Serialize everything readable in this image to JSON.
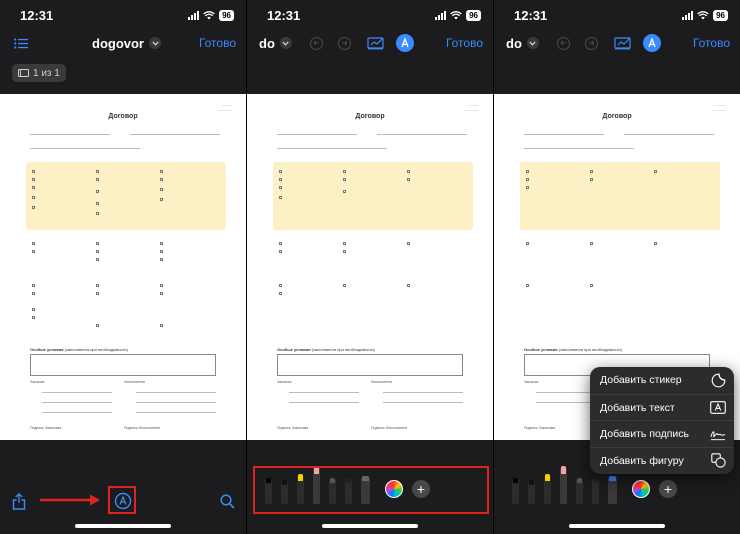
{
  "status": {
    "time": "12:31",
    "battery": "96"
  },
  "screens": [
    {
      "title": "dogovor",
      "done_label": "Готово",
      "page_indicator": "1 из 1"
    },
    {
      "title": "do",
      "done_label": "Готово"
    },
    {
      "title": "do",
      "done_label": "Готово"
    }
  ],
  "document": {
    "title": "Договор",
    "special_conditions": "Особые условия",
    "special_note": "(заполняется при необходимости)",
    "client_label": "Заказчик",
    "contractor_label": "Исполнитель",
    "sign_client": "Подпись Заказчика",
    "sign_contractor": "Подпись Исполнителя"
  },
  "menu": {
    "items": [
      {
        "label": "Добавить стикер",
        "icon": "sticker-icon"
      },
      {
        "label": "Добавить текст",
        "icon": "text-box-icon"
      },
      {
        "label": "Добавить подпись",
        "icon": "signature-icon"
      },
      {
        "label": "Добавить фигуру",
        "icon": "shapes-icon"
      }
    ]
  },
  "colors": {
    "accent": "#3a8bff",
    "highlight": "#e0231f",
    "doc_highlight": "#fdf0c4"
  }
}
